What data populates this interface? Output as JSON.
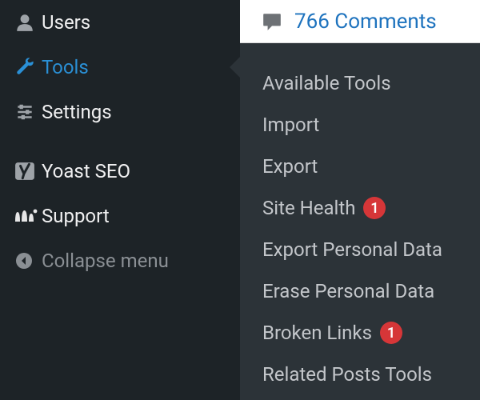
{
  "sidebar": {
    "items": [
      {
        "label": "Users"
      },
      {
        "label": "Tools"
      },
      {
        "label": "Settings"
      },
      {
        "label": "Yoast SEO"
      },
      {
        "label": "Support"
      },
      {
        "label": "Collapse menu"
      }
    ]
  },
  "comments": {
    "text": "766 Comments"
  },
  "submenu": {
    "items": [
      {
        "label": "Available Tools"
      },
      {
        "label": "Import"
      },
      {
        "label": "Export"
      },
      {
        "label": "Site Health",
        "badge": "1"
      },
      {
        "label": "Export Personal Data"
      },
      {
        "label": "Erase Personal Data"
      },
      {
        "label": "Broken Links",
        "badge": "1"
      },
      {
        "label": "Related Posts Tools"
      }
    ]
  },
  "colors": {
    "accent": "#2a90d6",
    "badge": "#d63638"
  }
}
